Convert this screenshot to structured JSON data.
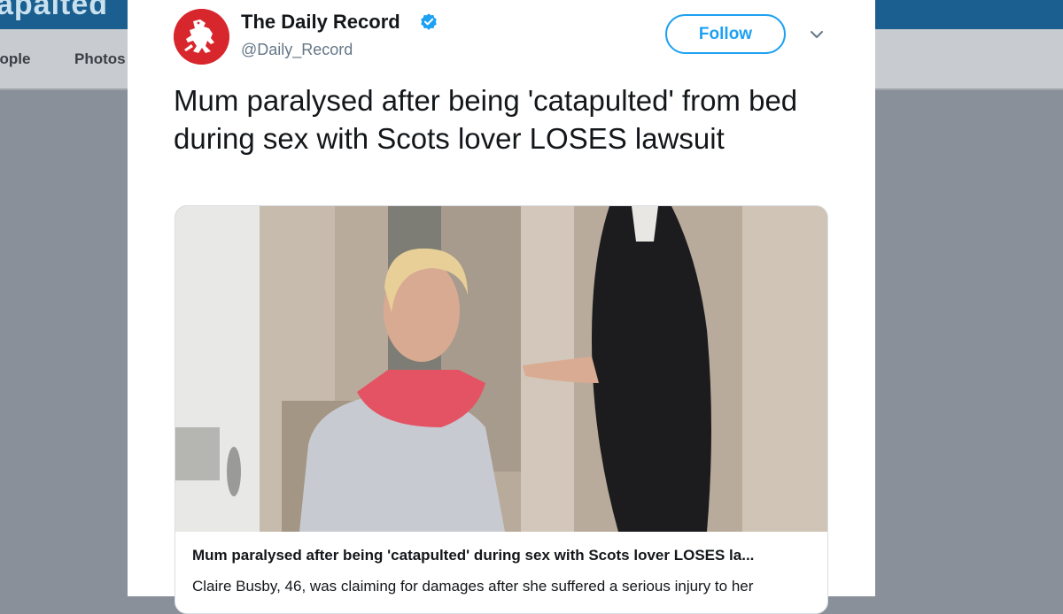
{
  "background": {
    "brand_fragment": "apaited",
    "nav": {
      "people": "eople",
      "photos": "Photos"
    }
  },
  "tweet": {
    "author_name": "The Daily Record",
    "handle": "@Daily_Record",
    "verified": true,
    "follow_label": "Follow",
    "text": "Mum paralysed after being 'catapulted' from bed during sex with Scots lover LOSES lawsuit",
    "card": {
      "title": "Mum paralysed after being 'catapulted' during sex with Scots lover LOSES la...",
      "description": "Claire Busby, 46, was claiming for damages after she suffered a serious injury to her"
    }
  },
  "icons": {
    "avatar": "red-lion-logo",
    "verified": "verified-badge-icon",
    "more": "chevron-down-icon"
  },
  "colors": {
    "accent": "#1da1f2",
    "avatar_bg": "#d8262d",
    "text": "#14171a",
    "muted": "#657786"
  }
}
